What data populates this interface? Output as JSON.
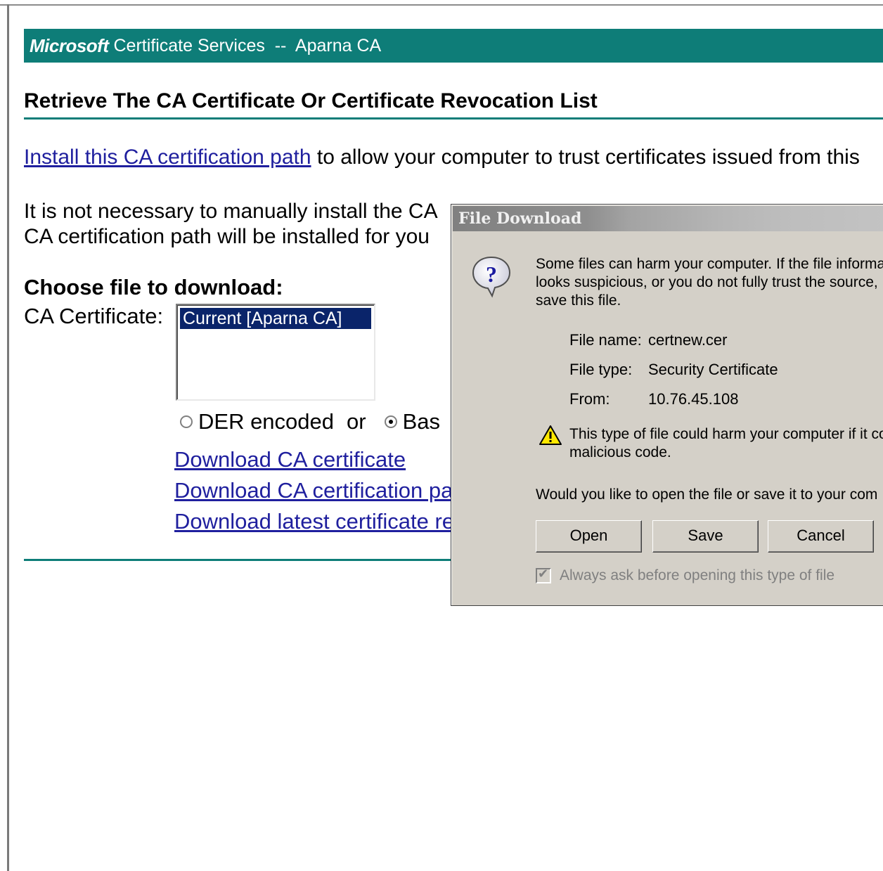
{
  "banner": {
    "brand": "Microsoft",
    "rest": "Certificate Services  --  Aparna CA"
  },
  "page": {
    "title": "Retrieve The CA Certificate Or Certificate Revocation List",
    "install_link": "Install this CA certification path",
    "install_rest": " to allow your computer to trust certificates issued from this",
    "note_line1": "It is not necessary to manually install the CA",
    "note_line2": "CA certification path will be installed for you",
    "choose_heading": "Choose file to download:",
    "ca_label": "CA Certificate:",
    "ca_list": [
      "Current [Aparna CA]"
    ],
    "radio_der": "DER encoded",
    "radio_or": "or",
    "radio_base": "Bas",
    "links": [
      "Download CA certificate",
      "Download CA certification pa",
      "Download latest certificate re"
    ]
  },
  "dialog": {
    "title": "File Download",
    "message": [
      "Some files can harm your computer. If the file informa",
      "looks suspicious, or you do not fully trust the source,",
      "save this file."
    ],
    "file_name_label": "File name:",
    "file_name": "certnew.cer",
    "file_type_label": "File type:",
    "file_type": "Security Certificate",
    "from_label": "From:",
    "from": "10.76.45.108",
    "warning": [
      "This type of file could harm your computer if it co",
      "malicious code."
    ],
    "question": "Would you like to open the file or save it to your com",
    "buttons": {
      "open": "Open",
      "save": "Save",
      "cancel": "Cancel"
    },
    "checkbox_label": "Always ask before opening this type of file",
    "checkbox_checked": true
  },
  "colors": {
    "banner_teal": "#0e7d78",
    "link_blue": "#1f1f9e",
    "selection_navy": "#0a246a",
    "dialog_face": "#d4d0c8"
  }
}
